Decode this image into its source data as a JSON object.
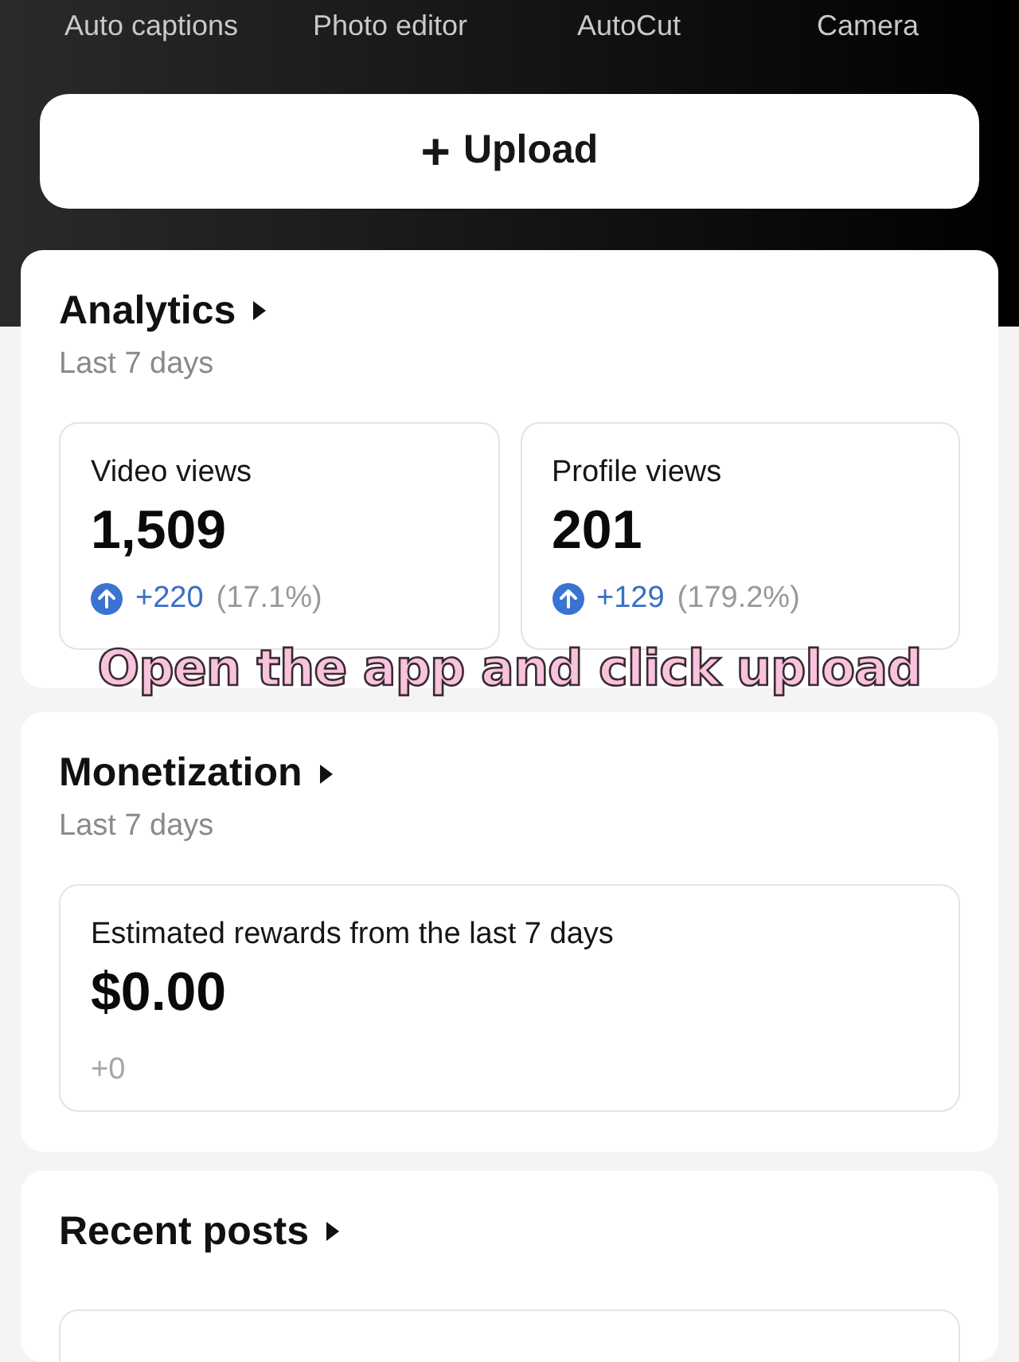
{
  "tools": [
    {
      "label": "Auto captions"
    },
    {
      "label": "Photo editor"
    },
    {
      "label": "AutoCut"
    },
    {
      "label": "Camera"
    }
  ],
  "upload_button": {
    "icon": "+",
    "label": "Upload"
  },
  "analytics": {
    "title": "Analytics",
    "period": "Last 7 days",
    "metrics": [
      {
        "label": "Video views",
        "value": "1,509",
        "change": "+220",
        "percent": "(17.1%)",
        "increased": true
      },
      {
        "label": "Profile views",
        "value": "201",
        "change": "+129",
        "percent": "(179.2%)",
        "increased": true
      }
    ]
  },
  "overlay_caption": "Open the app and click upload",
  "monetization": {
    "title": "Monetization",
    "period": "Last 7 days",
    "card": {
      "label": "Estimated rewards from the last 7 days",
      "value": "$0.00",
      "change": "+0"
    }
  },
  "recent_posts": {
    "title": "Recent posts"
  }
}
